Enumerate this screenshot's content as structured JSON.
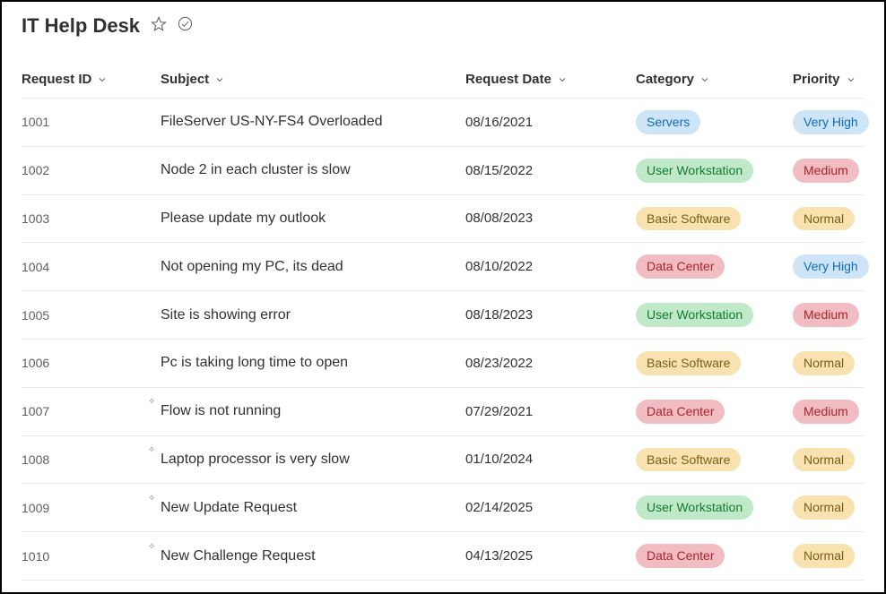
{
  "header": {
    "title": "IT Help Desk"
  },
  "columns": {
    "request_id": "Request ID",
    "subject": "Subject",
    "request_date": "Request Date",
    "category": "Category",
    "priority": "Priority"
  },
  "pill_classes": {
    "Servers": "pill-blue",
    "User Workstation": "pill-green",
    "Basic Software": "pill-yellow",
    "Data Center": "pill-red",
    "Very High": "pill-blue",
    "Medium": "pill-red",
    "Normal": "pill-yellow"
  },
  "rows": [
    {
      "id": "1001",
      "subject": "FileServer US-NY-FS4 Overloaded",
      "date": "08/16/2021",
      "category": "Servers",
      "priority": "Very High",
      "indicator": false
    },
    {
      "id": "1002",
      "subject": "Node 2 in each cluster is slow",
      "date": "08/15/2022",
      "category": "User Workstation",
      "priority": "Medium",
      "indicator": false
    },
    {
      "id": "1003",
      "subject": "Please update my outlook",
      "date": "08/08/2023",
      "category": "Basic Software",
      "priority": "Normal",
      "indicator": false
    },
    {
      "id": "1004",
      "subject": "Not opening my PC, its dead",
      "date": "08/10/2022",
      "category": "Data Center",
      "priority": "Very High",
      "indicator": false
    },
    {
      "id": "1005",
      "subject": "Site is showing error",
      "date": "08/18/2023",
      "category": "User Workstation",
      "priority": "Medium",
      "indicator": false
    },
    {
      "id": "1006",
      "subject": "Pc is taking long time to open",
      "date": "08/23/2022",
      "category": "Basic Software",
      "priority": "Normal",
      "indicator": false
    },
    {
      "id": "1007",
      "subject": "Flow is not running",
      "date": "07/29/2021",
      "category": "Data Center",
      "priority": "Medium",
      "indicator": true
    },
    {
      "id": "1008",
      "subject": "Laptop processor is very slow",
      "date": "01/10/2024",
      "category": "Basic Software",
      "priority": "Normal",
      "indicator": true
    },
    {
      "id": "1009",
      "subject": "New Update Request",
      "date": "02/14/2025",
      "category": "User Workstation",
      "priority": "Normal",
      "indicator": true
    },
    {
      "id": "1010",
      "subject": "New Challenge Request",
      "date": "04/13/2025",
      "category": "Data Center",
      "priority": "Normal",
      "indicator": true
    }
  ]
}
